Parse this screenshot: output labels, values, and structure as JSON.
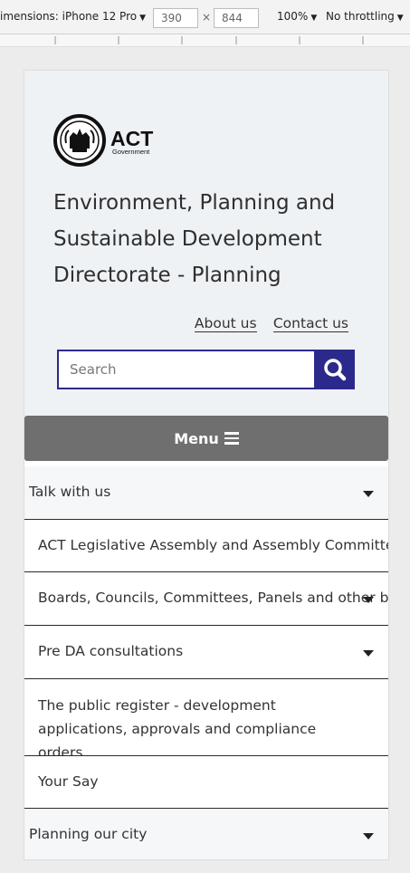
{
  "devtools": {
    "dimensions_label": "imensions: iPhone 12 Pro",
    "width_value": "390",
    "times": "×",
    "height_value": "844",
    "zoom": "100%",
    "throttling": "No throttling"
  },
  "header": {
    "logo_text_main": "ACT",
    "logo_text_sub": "Government",
    "title_line1": "Environment, Planning and",
    "title_line2": "Sustainable Development",
    "title_line3": "Directorate - Planning"
  },
  "links": {
    "about": "About us",
    "contact": "Contact us"
  },
  "search": {
    "placeholder": "Search",
    "value": ""
  },
  "menu": {
    "label": "Menu"
  },
  "nav": {
    "items": [
      {
        "label": "Talk with us",
        "has_arrow": true
      },
      {
        "label": "ACT Legislative Assembly and Assembly Committees",
        "has_arrow": false
      },
      {
        "label": "Boards, Councils, Committees, Panels and other bodies",
        "has_arrow": true
      },
      {
        "label": "Pre DA consultations",
        "has_arrow": true
      },
      {
        "label": "The public register - development applications, approvals and compliance orders",
        "has_arrow": false
      },
      {
        "label": "Your Say",
        "has_arrow": false
      },
      {
        "label": "Planning our city",
        "has_arrow": true
      }
    ]
  },
  "colors": {
    "accent": "#2b2a8c",
    "menu_bar": "#6f6f6f",
    "header_bg": "#eff2f5"
  }
}
